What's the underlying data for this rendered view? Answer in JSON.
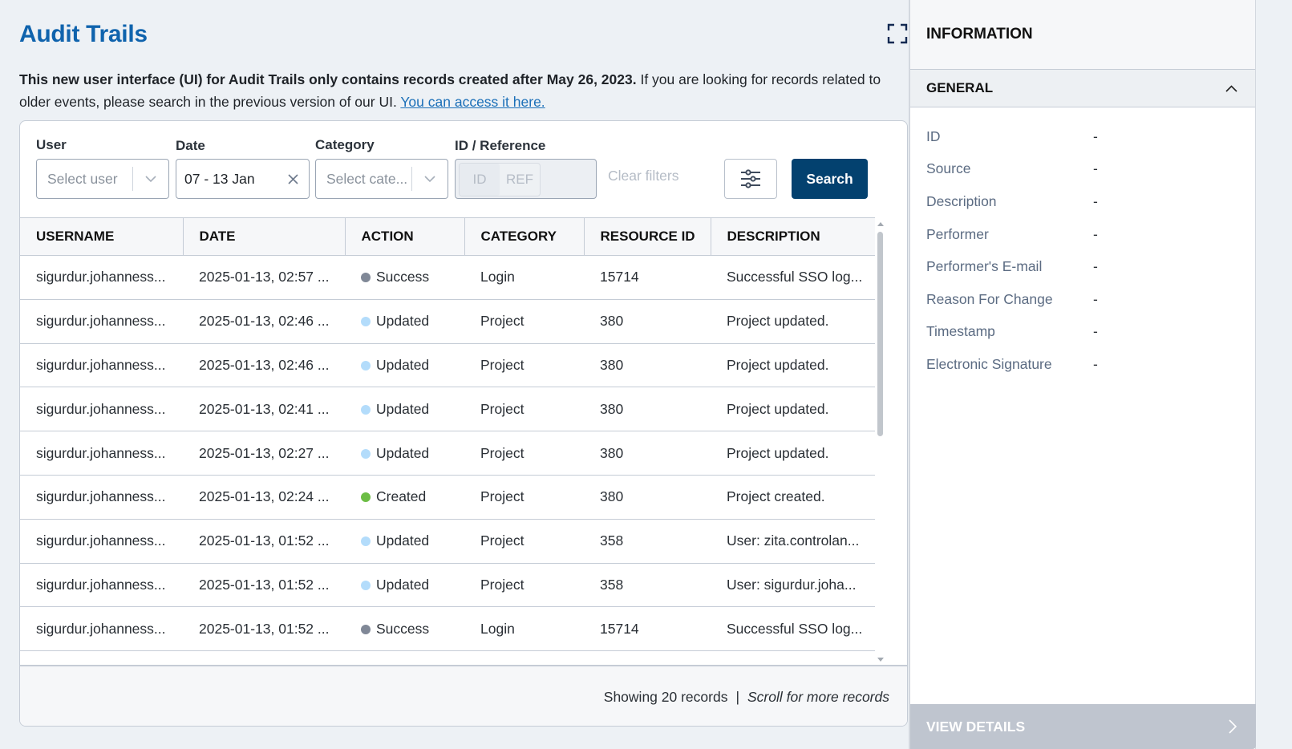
{
  "header": {
    "title": "Audit Trails",
    "expand_icon": "fullscreen-icon"
  },
  "notice": {
    "bold_text": "This new user interface (UI) for Audit Trails only contains records created after May 26, 2023.",
    "text": " If you are looking for records related to older events, please search in the previous version of our UI. ",
    "link_text": "You can access it here."
  },
  "filters": {
    "user": {
      "label": "User",
      "placeholder": "Select user"
    },
    "date": {
      "label": "Date",
      "value": "07 - 13 Jan"
    },
    "category": {
      "label": "Category",
      "placeholder": "Select cate..."
    },
    "id_reference": {
      "label": "ID / Reference",
      "options": [
        "ID",
        "REF"
      ],
      "selected": "ID"
    },
    "clear_filters": "Clear filters",
    "settings_icon": "sliders-icon",
    "search_label": "Search"
  },
  "table": {
    "columns": [
      "USERNAME",
      "DATE",
      "ACTION",
      "CATEGORY",
      "RESOURCE ID",
      "DESCRIPTION"
    ],
    "rows": [
      {
        "username": "sigurdur.johanness...",
        "date": "2025-01-13, 02:57 ...",
        "action": "Success",
        "status_color": "#808897",
        "category": "Login",
        "resource_id": "15714",
        "description": "Successful SSO log..."
      },
      {
        "username": "sigurdur.johanness...",
        "date": "2025-01-13, 02:46 ...",
        "action": "Updated",
        "status_color": "#b3dcfb",
        "category": "Project",
        "resource_id": "380",
        "description": "Project updated."
      },
      {
        "username": "sigurdur.johanness...",
        "date": "2025-01-13, 02:46 ...",
        "action": "Updated",
        "status_color": "#b3dcfb",
        "category": "Project",
        "resource_id": "380",
        "description": "Project updated."
      },
      {
        "username": "sigurdur.johanness...",
        "date": "2025-01-13, 02:41 ...",
        "action": "Updated",
        "status_color": "#b3dcfb",
        "category": "Project",
        "resource_id": "380",
        "description": "Project updated."
      },
      {
        "username": "sigurdur.johanness...",
        "date": "2025-01-13, 02:27 ...",
        "action": "Updated",
        "status_color": "#b3dcfb",
        "category": "Project",
        "resource_id": "380",
        "description": "Project updated."
      },
      {
        "username": "sigurdur.johanness...",
        "date": "2025-01-13, 02:24 ...",
        "action": "Created",
        "status_color": "#6cbd45",
        "category": "Project",
        "resource_id": "380",
        "description": "Project created."
      },
      {
        "username": "sigurdur.johanness...",
        "date": "2025-01-13, 01:52 ...",
        "action": "Updated",
        "status_color": "#b3dcfb",
        "category": "Project",
        "resource_id": "358",
        "description": "User: zita.controlan..."
      },
      {
        "username": "sigurdur.johanness...",
        "date": "2025-01-13, 01:52 ...",
        "action": "Updated",
        "status_color": "#b3dcfb",
        "category": "Project",
        "resource_id": "358",
        "description": "User: sigurdur.joha..."
      },
      {
        "username": "sigurdur.johanness...",
        "date": "2025-01-13, 01:52 ...",
        "action": "Success",
        "status_color": "#808897",
        "category": "Login",
        "resource_id": "15714",
        "description": "Successful SSO log..."
      }
    ]
  },
  "footer": {
    "showing": "Showing 20 records",
    "separator": "|",
    "scroll_hint": "Scroll for more records"
  },
  "info_panel": {
    "title": "INFORMATION",
    "section": "GENERAL",
    "fields": [
      {
        "key": "ID",
        "value": "-"
      },
      {
        "key": "Source",
        "value": "-"
      },
      {
        "key": "Description",
        "value": "-"
      },
      {
        "key": "Performer",
        "value": "-"
      },
      {
        "key": "Performer's E-mail",
        "value": "-"
      },
      {
        "key": "Reason For Change",
        "value": "-"
      },
      {
        "key": "Timestamp",
        "value": "-"
      },
      {
        "key": "Electronic Signature",
        "value": "-"
      }
    ],
    "view_details": "VIEW DETAILS"
  },
  "colors": {
    "title": "#0f63ad",
    "primary_button": "#03416f",
    "link": "#1b6fb8"
  }
}
